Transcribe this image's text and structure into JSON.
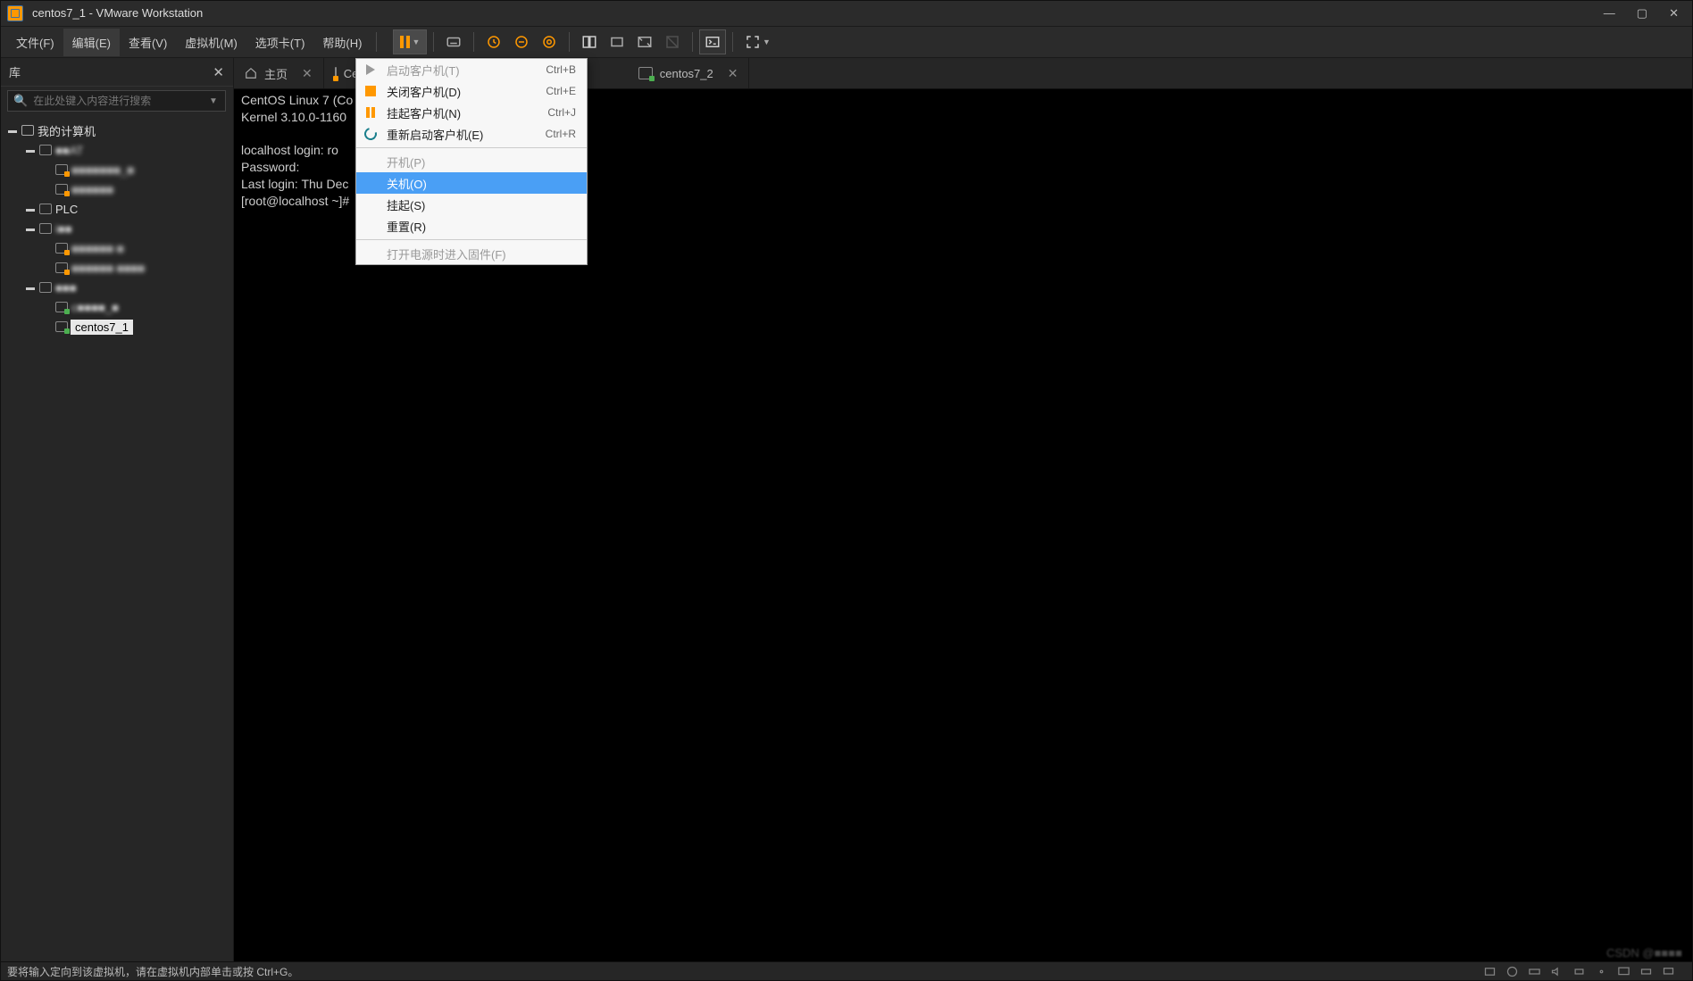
{
  "titlebar": {
    "title": "centos7_1 - VMware Workstation"
  },
  "menubar": {
    "file": "文件(F)",
    "edit": "编辑(E)",
    "view": "查看(V)",
    "vm": "虚拟机(M)",
    "tabs": "选项卡(T)",
    "help": "帮助(H)"
  },
  "sidebar": {
    "header": "库",
    "search_placeholder": "在此处键入内容进行搜索",
    "root": "我的计算机",
    "groups": [
      {
        "name": "■■AT",
        "children": [
          "■■■■■■■_■",
          "■■■■■■"
        ]
      },
      {
        "name": "PLC",
        "children": []
      },
      {
        "name": "i■■",
        "children": [
          "■■■■■■ ■",
          "■■■■■■ ■■■■"
        ]
      },
      {
        "name": "■■■",
        "children": [
          "c■■■■_■",
          "centos7_1"
        ]
      }
    ]
  },
  "tabs": {
    "home": "主页",
    "tab1": "Ce",
    "tab2": "centos7_2"
  },
  "terminal": {
    "line1": "CentOS Linux 7 (Co",
    "line2": "Kernel 3.10.0-1160",
    "line3": "",
    "line4": "localhost login: ro",
    "line5": "Password:",
    "line6": "Last login: Thu Dec",
    "line7": "[root@localhost ~]#"
  },
  "dropdown": {
    "start_guest": "启动客户机(T)",
    "start_guest_sc": "Ctrl+B",
    "close_guest": "关闭客户机(D)",
    "close_guest_sc": "Ctrl+E",
    "suspend_guest": "挂起客户机(N)",
    "suspend_guest_sc": "Ctrl+J",
    "restart_guest": "重新启动客户机(E)",
    "restart_guest_sc": "Ctrl+R",
    "power_on": "开机(P)",
    "power_off": "关机(O)",
    "suspend": "挂起(S)",
    "reset": "重置(R)",
    "firmware": "打开电源时进入固件(F)"
  },
  "statusbar": {
    "text": "要将输入定向到该虚拟机，请在虚拟机内部单击或按 Ctrl+G。"
  },
  "watermark": "CSDN @■■■■"
}
